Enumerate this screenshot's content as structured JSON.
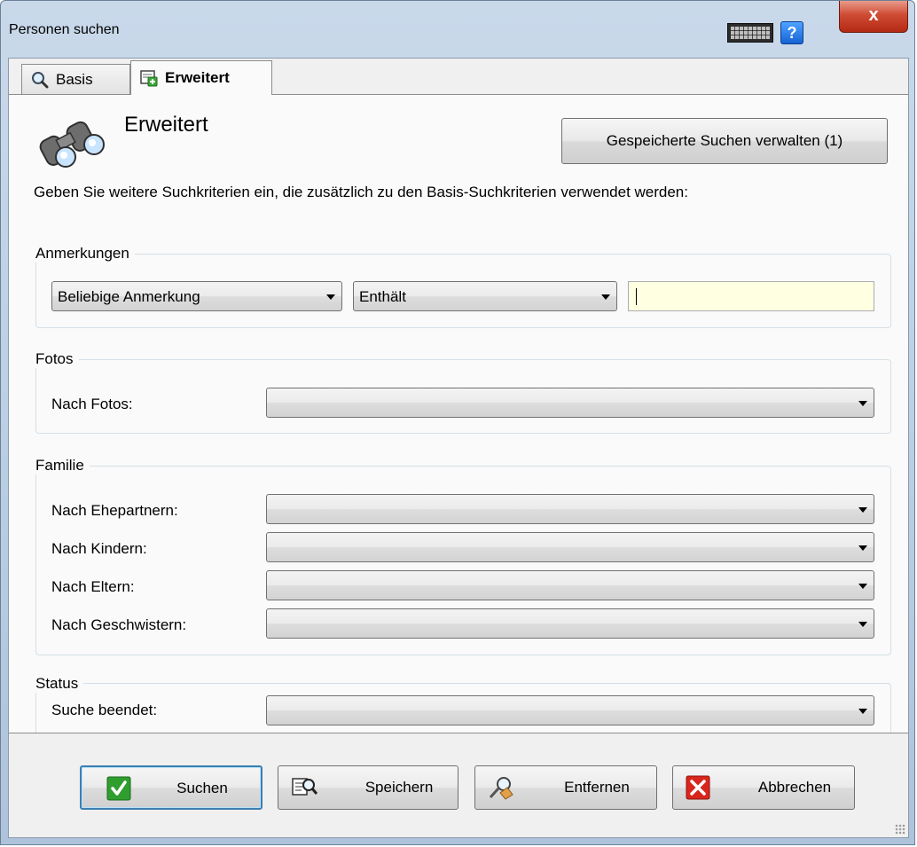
{
  "window": {
    "title": "Personen suchen",
    "help_glyph": "?",
    "close_glyph": "x",
    "icons": [
      "keyboard-icon",
      "help-icon",
      "close-icon"
    ]
  },
  "tabs": [
    {
      "label": "Basis",
      "icon": "magnifier-icon",
      "active": false
    },
    {
      "label": "Erweitert",
      "icon": "extended-search-icon",
      "active": true
    }
  ],
  "panel": {
    "heading": "Erweitert",
    "heading_icon": "binoculars-icon",
    "manage_button": "Gespeicherte Suchen verwalten (1)",
    "description": "Geben Sie weitere Suchkriterien ein, die zusätzlich zu den Basis-Suchkriterien verwendet werden:"
  },
  "groups": {
    "anmerkungen": {
      "title": "Anmerkungen",
      "field_select": "Beliebige Anmerkung",
      "operator_select": "Enthält",
      "text_value": ""
    },
    "fotos": {
      "title": "Fotos",
      "rows": [
        {
          "label": "Nach Fotos:",
          "value": ""
        }
      ]
    },
    "familie": {
      "title": "Familie",
      "rows": [
        {
          "label": "Nach Ehepartnern:",
          "value": ""
        },
        {
          "label": "Nach Kindern:",
          "value": ""
        },
        {
          "label": "Nach Eltern:",
          "value": ""
        },
        {
          "label": "Nach Geschwistern:",
          "value": ""
        }
      ]
    },
    "status": {
      "title": "Status",
      "rows": [
        {
          "label": "Suche beendet:",
          "value": ""
        }
      ]
    }
  },
  "actions": [
    {
      "label": "Suchen",
      "icon": "check-icon",
      "default": true
    },
    {
      "label": "Speichern",
      "icon": "save-search-icon",
      "default": false
    },
    {
      "label": "Entfernen",
      "icon": "eraser-icon",
      "default": false
    },
    {
      "label": "Abbrechen",
      "icon": "cancel-x-icon",
      "default": false
    }
  ],
  "colors": {
    "input_highlight": "#ffffe1",
    "close_button": "#c7412b",
    "check_green": "#2f9e2f",
    "cancel_red": "#d9261c",
    "default_button_border": "#3c7fb1"
  }
}
